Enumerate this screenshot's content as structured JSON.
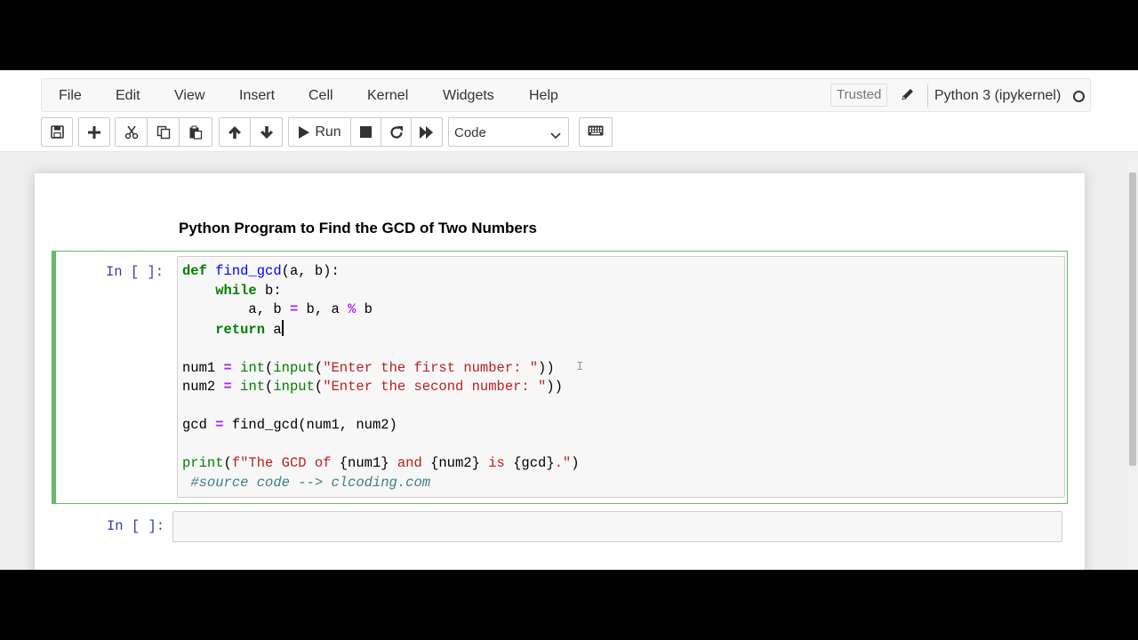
{
  "menu": {
    "items": [
      "File",
      "Edit",
      "View",
      "Insert",
      "Cell",
      "Kernel",
      "Widgets",
      "Help"
    ],
    "trusted": "Trusted",
    "kernel_name": "Python 3 (ipykernel)"
  },
  "toolbar": {
    "run_label": "Run",
    "cell_type": "Code",
    "icons": [
      "save-icon",
      "plus-icon",
      "scissors-icon",
      "copy-icon",
      "paste-icon",
      "arrow-up-icon",
      "arrow-down-icon",
      "play-icon",
      "stop-icon",
      "restart-icon",
      "fast-forward-icon",
      "keyboard-icon"
    ]
  },
  "notebook": {
    "markdown_title": "Python Program to Find the GCD of Two Numbers",
    "cell1_prompt": "In [ ]:",
    "cell2_prompt": "In [ ]:",
    "code": {
      "l1": {
        "kw": "def",
        "fn": "find_gcd",
        "rest": "(a, b):"
      },
      "l2": {
        "kw": "while",
        "rest": " b:"
      },
      "l3": {
        "a": "a, b ",
        "op1": "=",
        "b": " b, a ",
        "op2": "%",
        "c": " b"
      },
      "l4": {
        "kw": "return",
        "rest": " a"
      },
      "l6": {
        "a": "num1 ",
        "op": "=",
        "bi1": "int",
        "p1": "(",
        "bi2": "input",
        "p2": "(",
        "str": "\"Enter the first number: \"",
        "p3": "))"
      },
      "l7": {
        "a": "num2 ",
        "op": "=",
        "bi1": "int",
        "p1": "(",
        "bi2": "input",
        "p2": "(",
        "str": "\"Enter the second number: \"",
        "p3": "))"
      },
      "l9": {
        "a": "gcd ",
        "op": "=",
        "rest": " find_gcd(num1, num2)"
      },
      "l11": {
        "bi": "print",
        "p1": "(",
        "s1": "f\"The GCD of ",
        "i1": "{num1}",
        "s2": " and ",
        "i2": "{num2}",
        "s3": " is ",
        "i3": "{gcd}",
        "s4": ".\"",
        "p2": ")"
      },
      "l12": {
        "cm": "#source code --> clcoding.com"
      }
    }
  },
  "colors": {
    "keyword": "#008000",
    "operator": "#aa22ff",
    "string": "#ba2121",
    "function": "#0000ff",
    "comment": "#408080",
    "prompt": "#303f9f",
    "edit_border": "#66bb6a"
  }
}
